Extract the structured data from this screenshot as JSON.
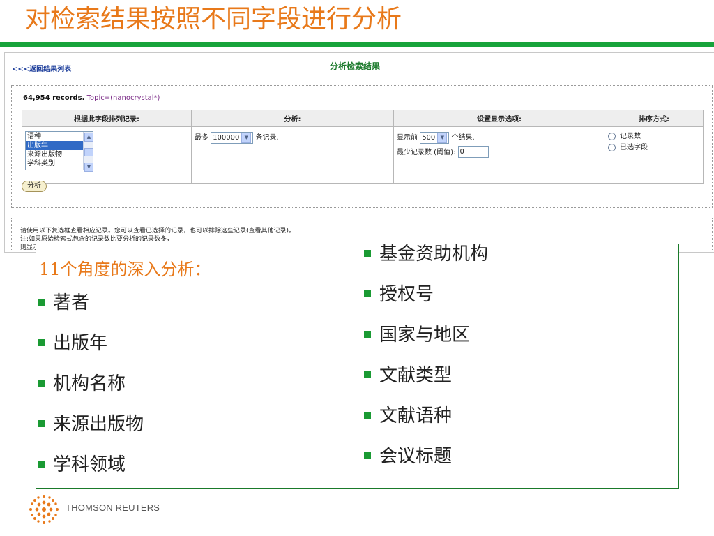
{
  "slide": {
    "title": "对检索结果按照不同字段进行分析"
  },
  "screenshot": {
    "back_link": "<<<返回结果列表",
    "page_title": "分析检索结果",
    "records_count": "64,954 records.",
    "query": "Topic=(nanocrystal*)",
    "table": {
      "headers": [
        "根据此字段排列记录:",
        "分析:",
        "设置显示选项:",
        "排序方式:"
      ],
      "field_options": [
        "语种",
        "出版年",
        "来源出版物",
        "学科类别"
      ],
      "selected_field": "出版年",
      "analyze_prefix": "最多",
      "analyze_value": "100000",
      "analyze_suffix": "条记录.",
      "show_prefix": "显示前",
      "show_value": "500",
      "show_suffix": "个结果.",
      "min_label": "最少记录数 (阈值):",
      "min_value": "0",
      "sort_options": [
        "记录数",
        "已选字段"
      ]
    },
    "analyze_button": "分析",
    "notes": [
      "请使用以下复选框查看相应记录。您可以查看已选择的记录，也可以排除这些记录(查看其他记录)。",
      "注:如果原始检索式包含的记录数比要分析的记录数多，",
      "则显示"
    ]
  },
  "overlay": {
    "heading": "11个角度的深入分析：",
    "left_items": [
      "著者",
      "出版年",
      "机构名称",
      "来源出版物",
      "学科领域"
    ],
    "right_items": [
      "基金资助机构",
      "授权号",
      "国家与地区",
      "文献类型",
      "文献语种",
      "会议标题"
    ],
    "bullet_color": "#1a9a33"
  },
  "brand": {
    "name": "THOMSON REUTERS",
    "accent": "#e8791a",
    "rule_color": "#17a33b"
  }
}
